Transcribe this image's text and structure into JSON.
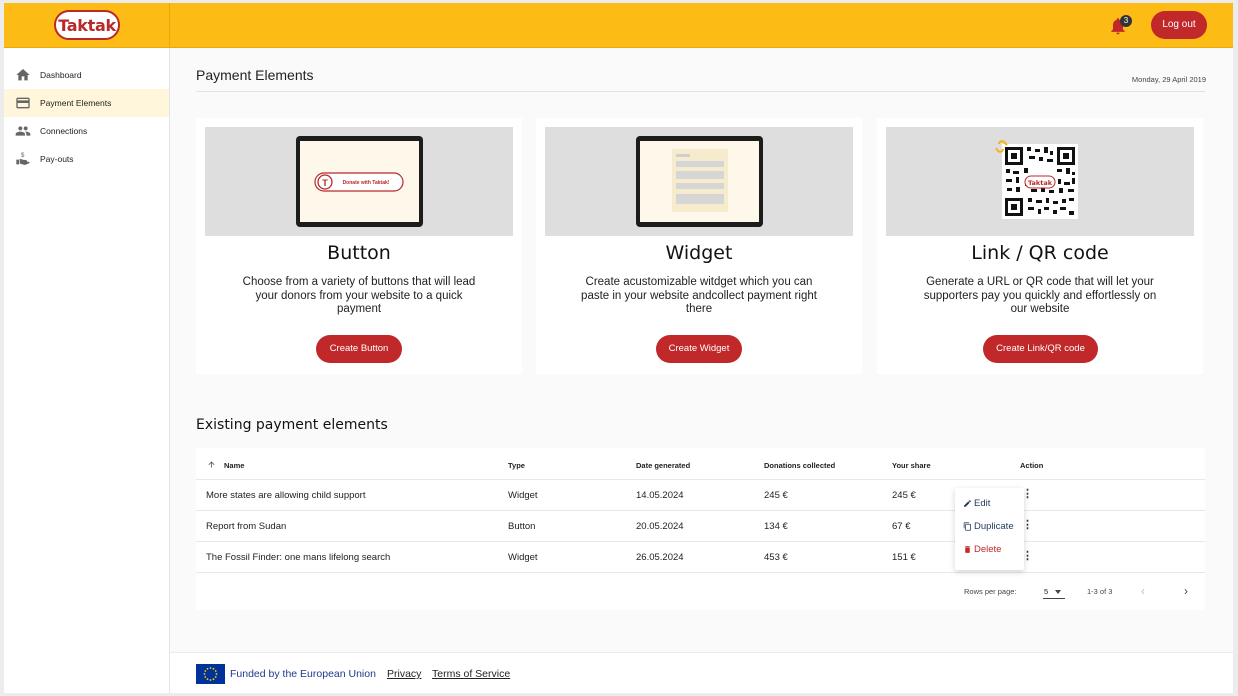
{
  "app": {
    "logo_text": "Taktak"
  },
  "topbar": {
    "notifications_count": "3",
    "logout_label": "Log out"
  },
  "sidebar": {
    "items": [
      {
        "label": "Dashboard",
        "icon": "home-icon",
        "active": false
      },
      {
        "label": "Payment Elements",
        "icon": "card-icon",
        "active": true
      },
      {
        "label": "Connections",
        "icon": "people-icon",
        "active": false
      },
      {
        "label": "Pay-outs",
        "icon": "payout-icon",
        "active": false
      }
    ]
  },
  "page": {
    "title": "Payment Elements",
    "date": "Monday, 29 April 2019"
  },
  "cards": [
    {
      "title": "Button",
      "description": "Choose from a variety of buttons that will lead your donors from your website to a quick payment",
      "button_label": "Create Button",
      "preview_text": "Donate with Taktak!"
    },
    {
      "title": "Widget",
      "description": "Create acustomizable witdget which you can paste in your website andcollect payment right there",
      "button_label": "Create Widget"
    },
    {
      "title": "Link / QR code",
      "description": "Generate a URL or QR code that will let your supporters pay you quickly and effortlessly on our website",
      "button_label": "Create Link/QR code",
      "qr_logo_text": "Taktak"
    }
  ],
  "existing": {
    "title": "Existing payment elements",
    "columns": [
      "Name",
      "Type",
      "Date generated",
      "Donations collected",
      "Your share",
      "Action"
    ],
    "rows": [
      {
        "name": "More states are allowing child support",
        "type": "Widget",
        "date": "14.05.2024",
        "donations": "245 €",
        "share": "245 €"
      },
      {
        "name": "Report from Sudan",
        "type": "Button",
        "date": "20.05.2024",
        "donations": "134 €",
        "share": "67 €"
      },
      {
        "name": "The Fossil Finder: one mans lifelong search",
        "type": "Widget",
        "date": "26.05.2024",
        "donations": "453 €",
        "share": "151 €"
      }
    ],
    "rows_per_page_label": "Rows per page:",
    "rows_per_page_value": "5",
    "range_text": "1-3 of 3",
    "action_menu": {
      "edit": "Edit",
      "duplicate": "Duplicate",
      "delete": "Delete"
    }
  },
  "footer": {
    "eu_text": "Funded by the European Union",
    "privacy": "Privacy",
    "terms": "Terms of Service"
  },
  "colors": {
    "brand_yellow": "#fdbb16",
    "brand_red": "#c0282a"
  }
}
